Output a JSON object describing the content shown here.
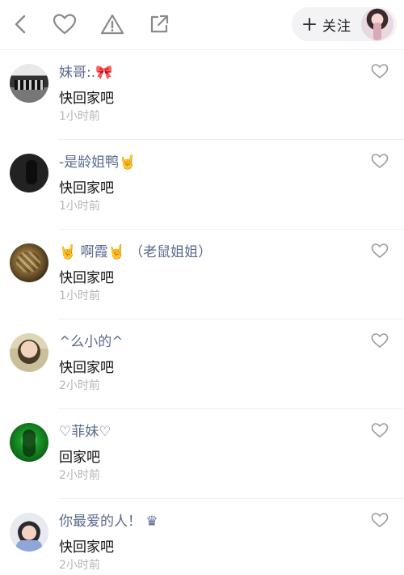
{
  "header": {
    "follow_label": "关注",
    "icons": [
      "back-icon",
      "heart-outline-icon",
      "warning-icon",
      "share-icon"
    ]
  },
  "comments": [
    {
      "username": "妹哥:.🎀",
      "content": "快回家吧",
      "time": "1小时前"
    },
    {
      "username": "-是龄姐鸭🤘",
      "content": "快回家吧",
      "time": "1小时前"
    },
    {
      "username": "🤘 啊霞🤘 （老鼠姐姐）",
      "content": "快回家吧",
      "time": "1小时前"
    },
    {
      "username": "^么小的^",
      "content": "快回家吧",
      "time": "2小时前"
    },
    {
      "username": "♡菲妹♡",
      "content": "回家吧",
      "time": "2小时前"
    },
    {
      "username": "你最爱的人！ ♛",
      "content": "快回家吧",
      "time": "2小时前"
    }
  ],
  "colors": {
    "username": "#5a6a8e",
    "content": "#111111",
    "time": "#b5b5b5",
    "icon": "#8a8a8a"
  }
}
